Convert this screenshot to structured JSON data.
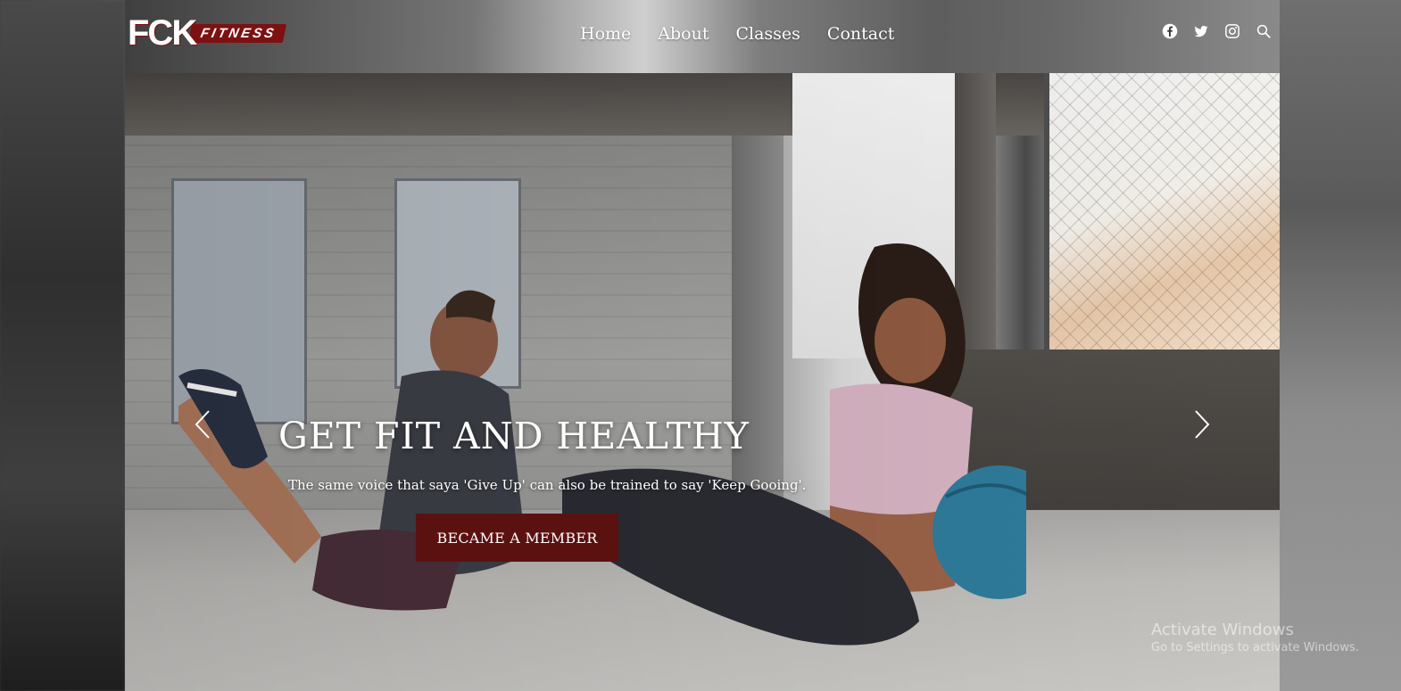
{
  "brand": {
    "logo_mark": "FCK",
    "logo_tag": "FITNESS"
  },
  "nav": {
    "items": [
      {
        "label": "Home"
      },
      {
        "label": "About"
      },
      {
        "label": "Classes"
      },
      {
        "label": "Contact"
      }
    ]
  },
  "social": {
    "icons": [
      "facebook-icon",
      "twitter-icon",
      "instagram-icon",
      "search-icon"
    ]
  },
  "hero": {
    "title": "GET FIT AND HEALTHY",
    "subtitle": "The same voice that saya 'Give Up' can also be trained to say 'Keep Gooing'.",
    "cta_label": "BECAME A MEMBER",
    "prev_icon": "chevron-left-icon",
    "next_icon": "chevron-right-icon"
  },
  "watermark": {
    "line1": "Activate Windows",
    "line2": "Go to Settings to activate Windows."
  },
  "colors": {
    "brand_red": "#7d1111",
    "cta_bg": "#5c1111",
    "text_light": "#ffffff"
  }
}
